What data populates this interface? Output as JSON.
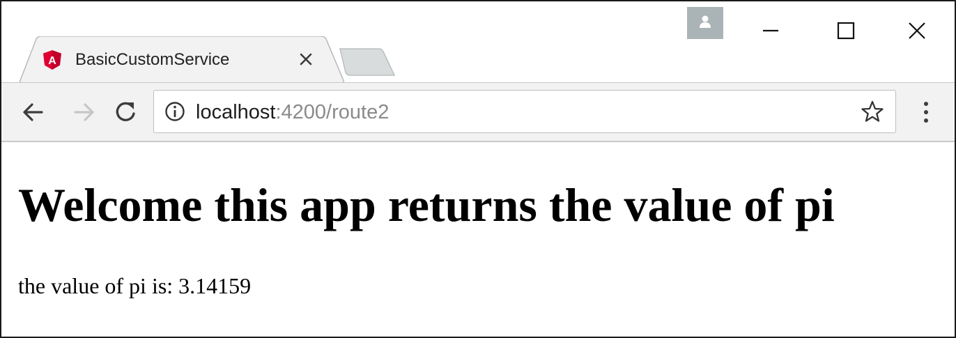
{
  "browser": {
    "tab": {
      "title": "BasicCustomService",
      "favicon": "angular-logo-icon",
      "favicon_letter": "A",
      "favicon_color": "#dd0031"
    },
    "address_bar": {
      "host": "localhost",
      "rest": ":4200/route2"
    },
    "icons": {
      "back": "arrow-left-icon",
      "forward": "arrow-right-icon",
      "reload": "reload-icon",
      "info": "info-icon",
      "bookmark": "star-icon",
      "menu": "kebab-menu-icon",
      "profile": "profile-icon",
      "minimize": "minimize-icon",
      "maximize": "maximize-icon",
      "close": "close-icon"
    }
  },
  "page": {
    "heading": "Welcome this app returns the value of pi",
    "pi_text": "the value of pi is: 3.14159"
  }
}
